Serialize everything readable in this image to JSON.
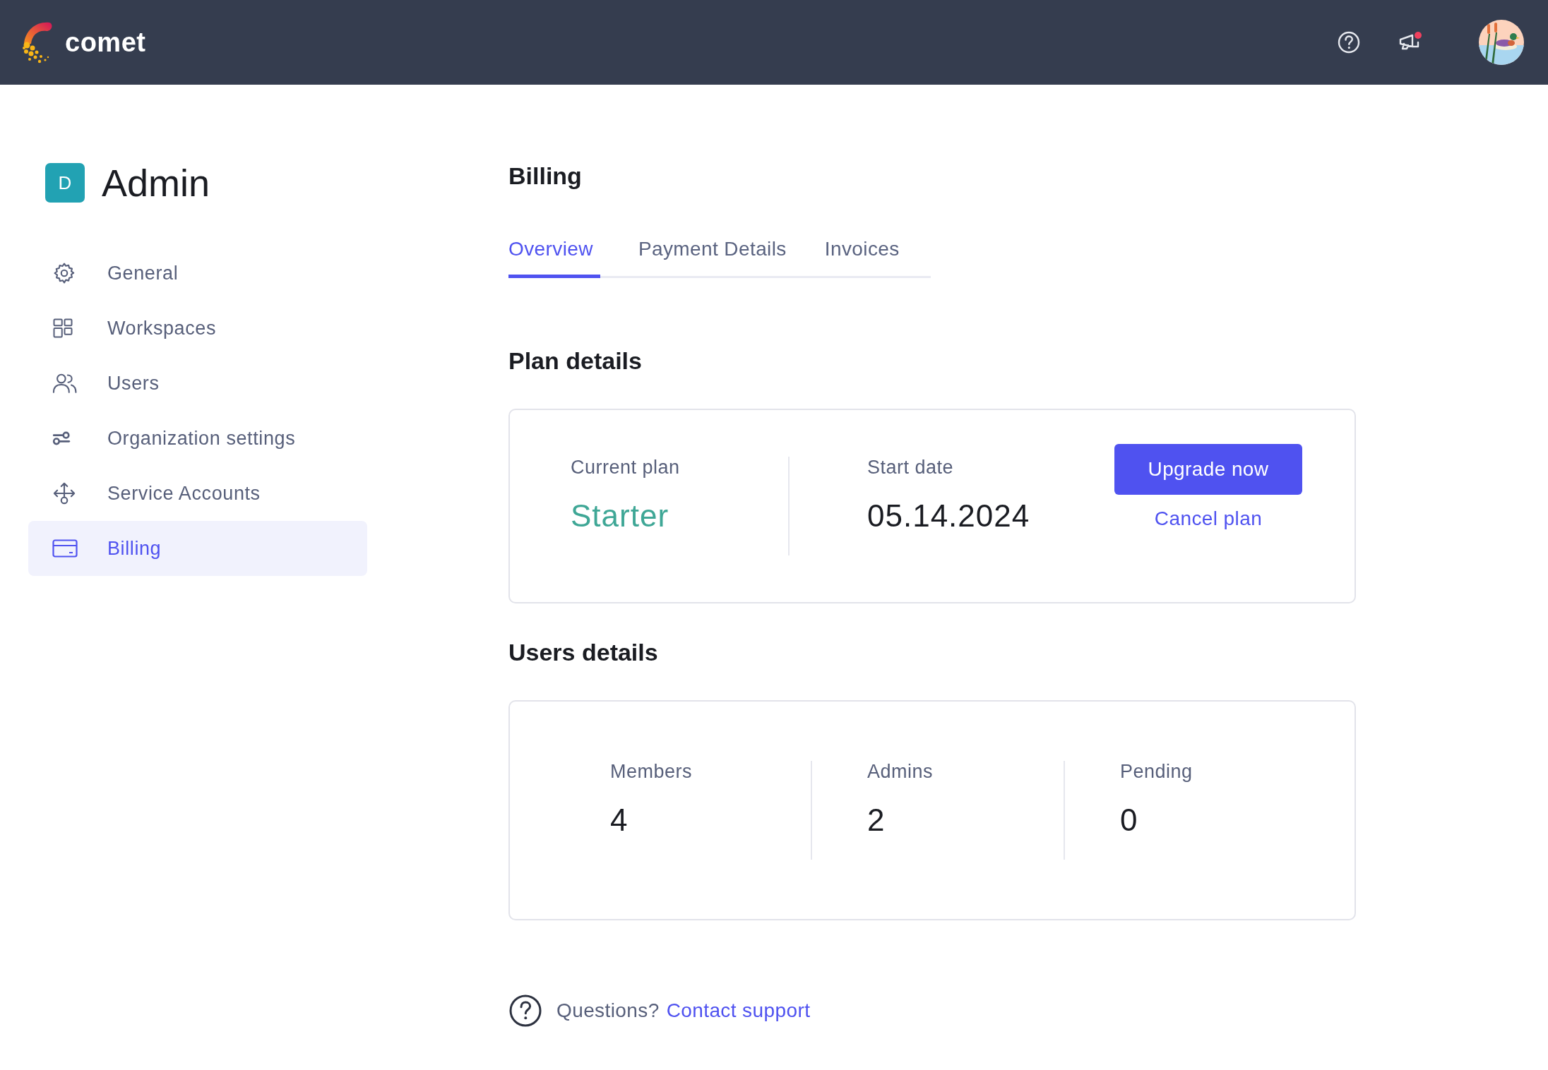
{
  "header": {
    "logo_text": "comet",
    "notification_unread": true
  },
  "sidebar": {
    "badge": "D",
    "title": "Admin",
    "items": [
      {
        "label": "General",
        "selected": false
      },
      {
        "label": "Workspaces",
        "selected": false
      },
      {
        "label": "Users",
        "selected": false
      },
      {
        "label": "Organization settings",
        "selected": false
      },
      {
        "label": "Service Accounts",
        "selected": false
      },
      {
        "label": "Billing",
        "selected": true
      }
    ]
  },
  "page_title": "Billing",
  "tabs": [
    {
      "label": "Overview",
      "selected": true
    },
    {
      "label": "Payment Details",
      "selected": false
    },
    {
      "label": "Invoices",
      "selected": false
    }
  ],
  "plan_details": {
    "heading": "Plan details",
    "current_plan_label": "Current plan",
    "current_plan": "Starter",
    "start_date_label": "Start date",
    "start_date": "05.14.2024",
    "upgrade_button": "Upgrade now",
    "cancel_link": "Cancel plan"
  },
  "users_details": {
    "heading": "Users details",
    "stats": [
      {
        "label": "Members",
        "value": "4"
      },
      {
        "label": "Admins",
        "value": "2"
      },
      {
        "label": "Pending",
        "value": "0"
      }
    ]
  },
  "footer": {
    "question": "Questions?",
    "link": "Contact support"
  }
}
